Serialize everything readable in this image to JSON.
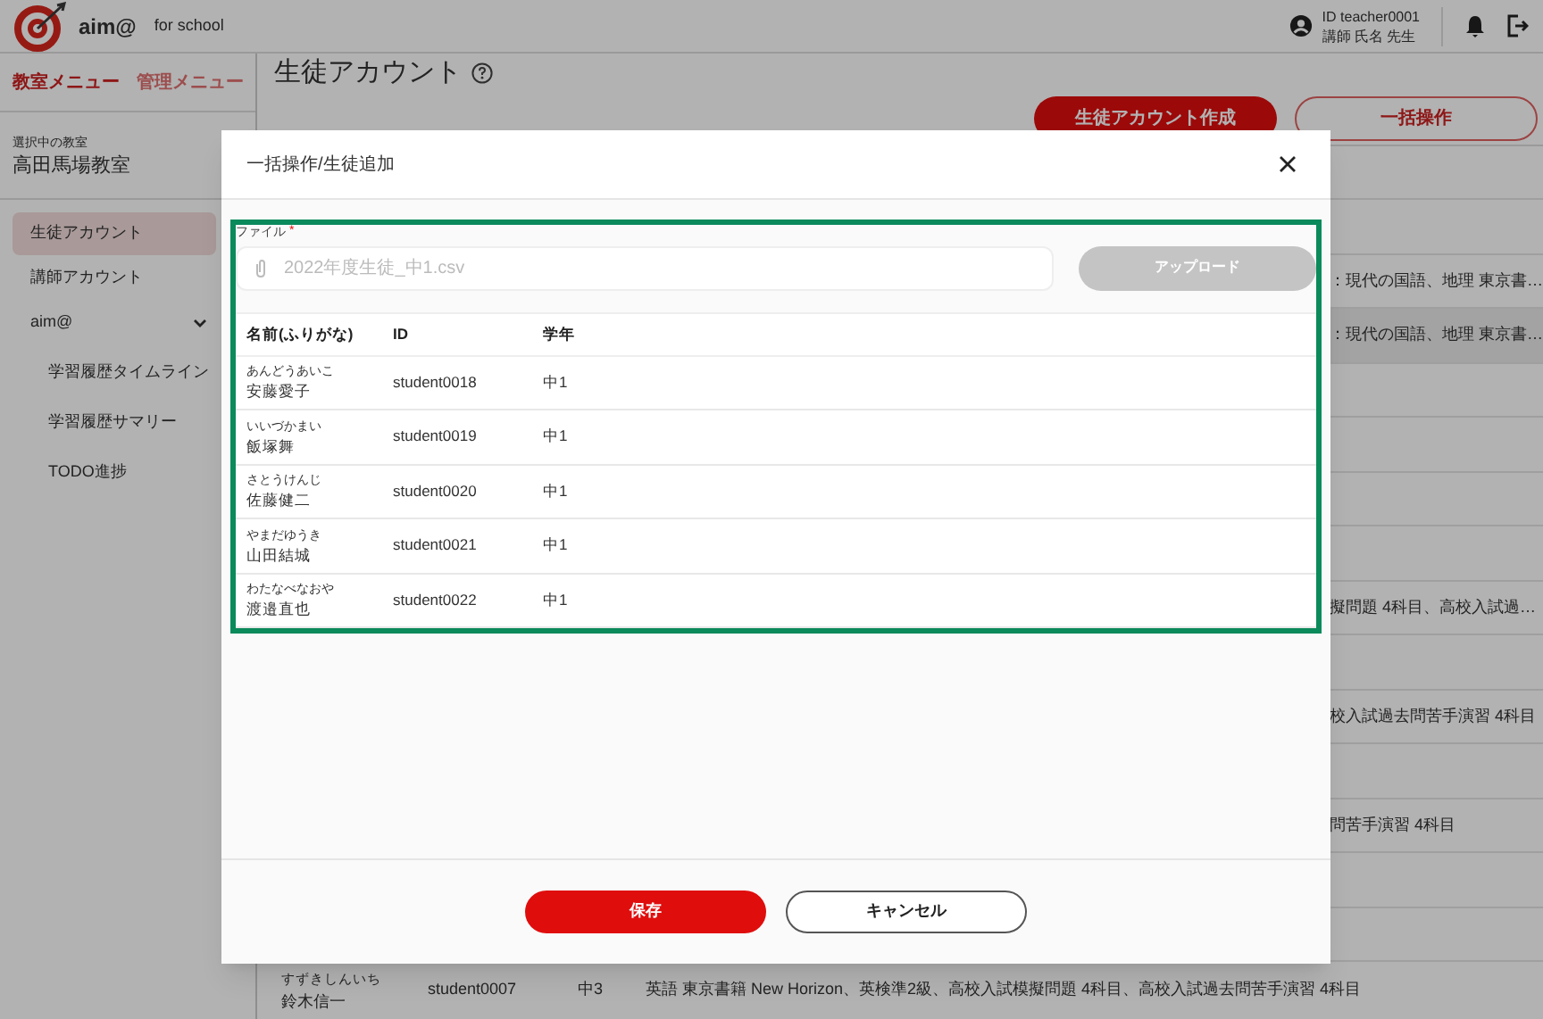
{
  "header": {
    "logo_text": "aim@",
    "logo_suffix": "for school",
    "user_id": "ID teacher0001",
    "user_name": "講師 氏名 先生"
  },
  "sidebar": {
    "tabs": [
      {
        "label": "教室メニュー",
        "selected": true
      },
      {
        "label": "管理メニュー",
        "selected": false
      }
    ],
    "classroom_label": "選択中の教室",
    "classroom_name": "高田馬場教室",
    "items": [
      {
        "label": "生徒アカウント",
        "selected": true
      },
      {
        "label": "講師アカウント",
        "selected": false
      },
      {
        "label": "aim@",
        "selected": false,
        "expanded": true,
        "children": [
          {
            "label": "学習履歴タイムライン",
            "selected": false
          },
          {
            "label": "学習履歴サマリー",
            "selected": false
          },
          {
            "label": "TODO進捗",
            "selected": false
          }
        ]
      }
    ]
  },
  "page": {
    "title": "生徒アカウント",
    "buttons": [
      {
        "label": "生徒アカウント作成",
        "kind": "primary"
      },
      {
        "label": "一括操作",
        "kind": "outline"
      }
    ],
    "rows": [
      {
        "subjects": ""
      },
      {
        "subjects": ""
      },
      {
        "subjects": "：現代の国語、地理 東京書…",
        "selected": false
      },
      {
        "subjects": "：現代の国語、地理 東京書…",
        "selected": true
      },
      {
        "subjects": ""
      },
      {
        "subjects": ""
      },
      {
        "subjects": ""
      },
      {
        "subjects": ""
      },
      {
        "subjects": "擬問題 4科目、高校入試過…"
      },
      {
        "subjects": ""
      },
      {
        "subjects": "校入試過去問苦手演習 4科目"
      },
      {
        "subjects": ""
      },
      {
        "subjects": "問苦手演習 4科目"
      },
      {
        "subjects": ""
      },
      {
        "subjects": ""
      }
    ],
    "last_row": {
      "kana": "すずきしんいち",
      "name": "鈴木信一",
      "id": "student0007",
      "grade": "中3",
      "subjects": "英語 東京書籍 New Horizon、英検準2級、高校入試模擬問題 4科目、高校入試過去問苦手演習 4科目"
    }
  },
  "modal": {
    "title": "一括操作/生徒追加",
    "file_label": "ファイル",
    "required_mark": "*",
    "file_value": "2022年度生徒_中1.csv",
    "upload_button": {
      "label": "アップロード",
      "disabled": true
    },
    "columns": [
      "名前(ふりがな)",
      "ID",
      "学年"
    ],
    "rows": [
      {
        "kana": "あんどうあいこ",
        "name": "安藤愛子",
        "id": "student0018",
        "grade": "中1"
      },
      {
        "kana": "いいづかまい",
        "name": "飯塚舞",
        "id": "student0019",
        "grade": "中1"
      },
      {
        "kana": "さとうけんじ",
        "name": "佐藤健二",
        "id": "student0020",
        "grade": "中1"
      },
      {
        "kana": "やまだゆうき",
        "name": "山田結城",
        "id": "student0021",
        "grade": "中1"
      },
      {
        "kana": "わたなべなおや",
        "name": "渡邉直也",
        "id": "student0022",
        "grade": "中1"
      }
    ],
    "save": "保存",
    "cancel": "キャンセル"
  }
}
